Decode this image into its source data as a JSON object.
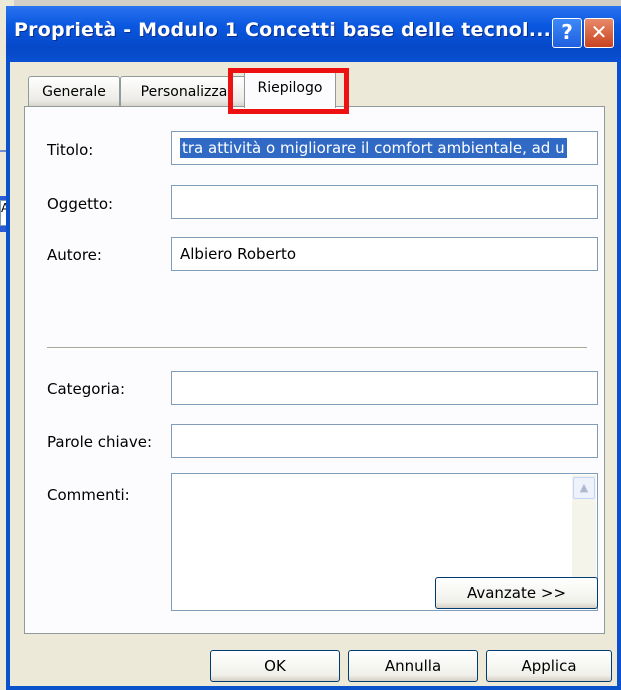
{
  "window": {
    "title": "Proprietà - Modulo 1 Concetti base delle tecnol...",
    "help_glyph": "?",
    "close_glyph": "✕"
  },
  "background_app": {
    "partial_button_text": "Ap"
  },
  "tabs": [
    {
      "label": "Generale",
      "active": false
    },
    {
      "label": "Personalizza",
      "active": false
    },
    {
      "label": "Riepilogo",
      "active": true
    }
  ],
  "highlight_color": "#ee1111",
  "form": {
    "titolo": {
      "label": "Titolo:",
      "value": "tra attività o migliorare il comfort ambientale, ad u"
    },
    "oggetto": {
      "label": "Oggetto:",
      "value": ""
    },
    "autore": {
      "label": "Autore:",
      "value": "Albiero Roberto"
    },
    "categoria": {
      "label": "Categoria:",
      "value": ""
    },
    "parole_chiave": {
      "label": "Parole chiave:",
      "value": ""
    },
    "commenti": {
      "label": "Commenti:",
      "value": ""
    }
  },
  "scroll_icons": {
    "up": "▲",
    "down": "▼"
  },
  "buttons": {
    "avanzate": "Avanzate >>",
    "ok": "OK",
    "annulla": "Annulla",
    "applica": "Applica"
  }
}
